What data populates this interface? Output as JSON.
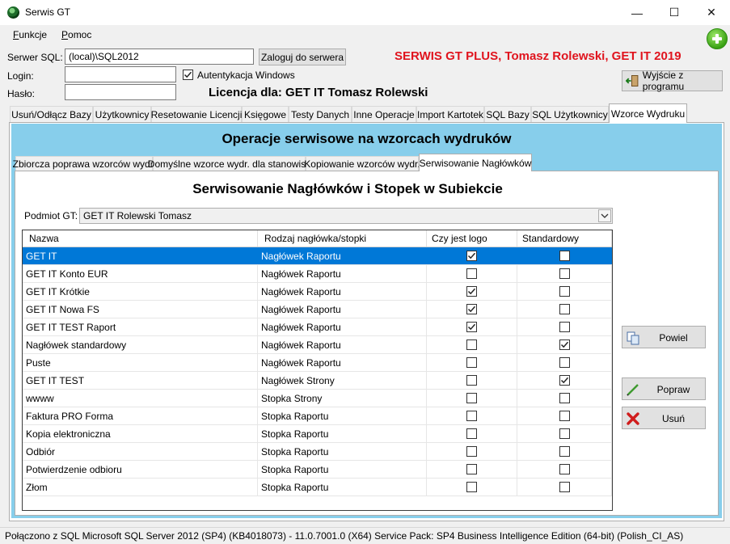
{
  "window": {
    "title": "Serwis GT",
    "min_glyph": "—",
    "max_glyph": "☐",
    "close_glyph": "✕"
  },
  "menu": [
    {
      "label": "Funkcje"
    },
    {
      "label": "Pomoc"
    }
  ],
  "login": {
    "server_label": "Serwer SQL:",
    "server_value": "(local)\\SQL2012",
    "login_button": "Zaloguj do serwera",
    "login_label": "Login:",
    "login_value": "",
    "windows_auth_label": "Autentykacja Windows",
    "windows_auth_checked": true,
    "password_label": "Hasło:",
    "password_value": ""
  },
  "brand": "SERWIS GT PLUS, Tomasz Rolewski, GET IT 2019",
  "licence": "Licencja dla: GET IT Tomasz Rolewski",
  "exit_button": "Wyjście z programu",
  "main_tabs": [
    "Usuń/Odłącz Bazy",
    "Użytkownicy",
    "Resetowanie Licencji",
    "Księgowe",
    "Testy Danych",
    "Inne Operacje",
    "Import Kartotek",
    "SQL Bazy",
    "SQL Użytkownicy",
    "Wzorce Wydruku"
  ],
  "active_main_tab": "Wzorce Wydruku",
  "panel_title": "Operacje serwisowe na wzorcach wydruków",
  "sub_tabs": [
    "Zbiorcza poprawa wzorców wydr.",
    "Domyślne wzorce wydr. dla stanowisk",
    "Kopiowanie wzorców wydr.",
    "Serwisowanie Nagłówków"
  ],
  "active_sub_tab": "Serwisowanie Nagłówków",
  "section_title": "Serwisowanie Nagłówków i Stopek w Subiekcie",
  "subject": {
    "label": "Podmiot GT:",
    "value": "GET IT Rolewski Tomasz"
  },
  "grid": {
    "columns": [
      "Nazwa",
      "Rodzaj nagłówka/stopki",
      "Czy jest logo",
      "Standardowy"
    ],
    "selected_index": 0,
    "rows": [
      {
        "name": "GET IT",
        "type": "Nagłówek Raportu",
        "logo": true,
        "standard": false
      },
      {
        "name": "GET IT Konto EUR",
        "type": "Nagłówek Raportu",
        "logo": false,
        "standard": false
      },
      {
        "name": "GET IT Krótkie",
        "type": "Nagłówek Raportu",
        "logo": true,
        "standard": false
      },
      {
        "name": "GET IT Nowa FS",
        "type": "Nagłówek Raportu",
        "logo": true,
        "standard": false
      },
      {
        "name": "GET IT TEST Raport",
        "type": "Nagłówek Raportu",
        "logo": true,
        "standard": false
      },
      {
        "name": "Nagłówek standardowy",
        "type": "Nagłówek Raportu",
        "logo": false,
        "standard": true
      },
      {
        "name": "Puste",
        "type": "Nagłówek Raportu",
        "logo": false,
        "standard": false
      },
      {
        "name": "GET IT TEST",
        "type": "Nagłówek Strony",
        "logo": false,
        "standard": true
      },
      {
        "name": "wwww",
        "type": "Stopka Strony",
        "logo": false,
        "standard": false
      },
      {
        "name": "Faktura PRO Forma",
        "type": "Stopka Raportu",
        "logo": false,
        "standard": false
      },
      {
        "name": "Kopia elektroniczna",
        "type": "Stopka Raportu",
        "logo": false,
        "standard": false
      },
      {
        "name": "Odbiór",
        "type": "Stopka Raportu",
        "logo": false,
        "standard": false
      },
      {
        "name": "Potwierdzenie odbioru",
        "type": "Stopka Raportu",
        "logo": false,
        "standard": false
      },
      {
        "name": "Złom",
        "type": "Stopka Raportu",
        "logo": false,
        "standard": false
      }
    ]
  },
  "actions": {
    "duplicate": "Powiel",
    "edit": "Popraw",
    "delete": "Usuń"
  },
  "status": "Połączono z SQL  Microsoft SQL Server 2012 (SP4) (KB4018073) - 11.0.7001.0 (X64)  Service Pack: SP4 Business Intelligence Edition (64-bit) (Polish_CI_AS)",
  "colors": {
    "brand_red": "#e0141e",
    "panel_blue": "#87ceeb",
    "selection": "#0078d7"
  }
}
